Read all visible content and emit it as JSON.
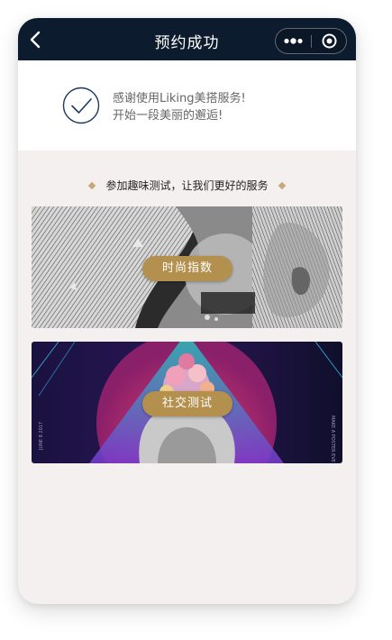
{
  "navbar": {
    "title": "预约成功",
    "back_icon": "chevron-left-icon",
    "more_icon": "more-dots-icon",
    "close_icon": "target-circle-icon"
  },
  "success": {
    "icon": "check-circle-icon",
    "line1": "感谢使用Liking美搭服务!",
    "line2": "开始一段美丽的邂逅!"
  },
  "section": {
    "title": "参加趣味测试，让我们更好的服务"
  },
  "banners": [
    {
      "label": "时尚指数"
    },
    {
      "label": "社交测试",
      "side_text_left": "JUNE 8 2017",
      "side_text_right": "MAKE A POSTER EVE"
    }
  ],
  "colors": {
    "navbar": "#0d1b2e",
    "accent_gold": "#b3904e",
    "check_blue": "#1d3a5e",
    "background": "#f4f0ef"
  }
}
